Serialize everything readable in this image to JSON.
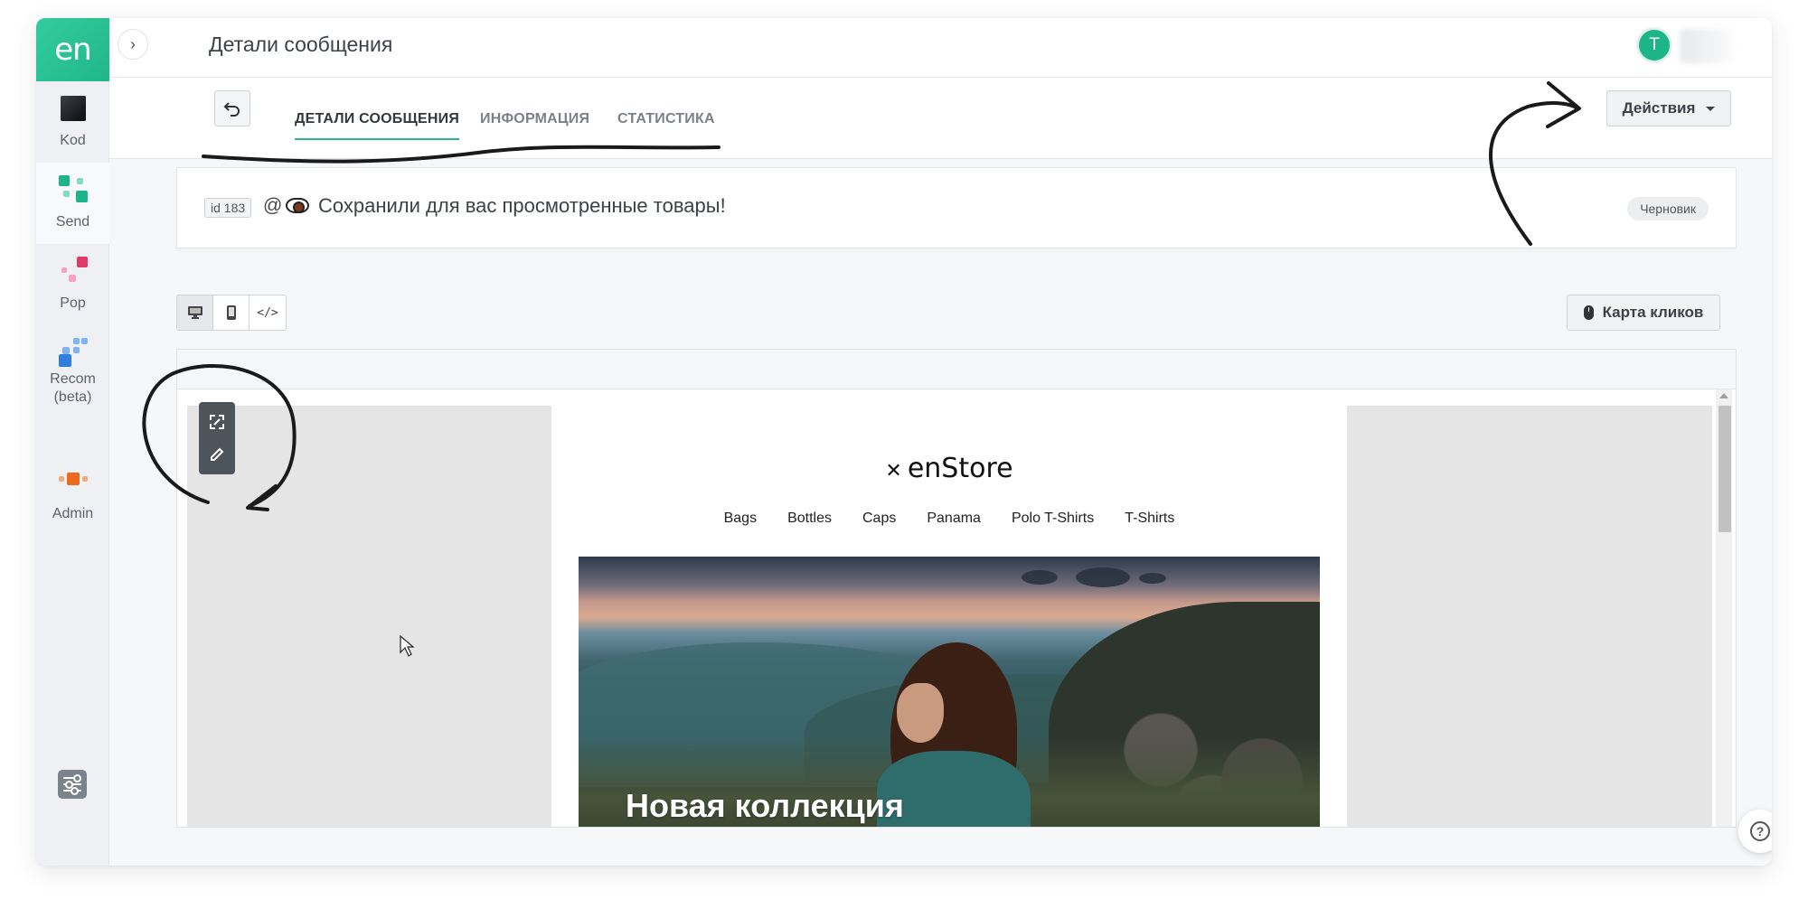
{
  "sidebar": {
    "logo": "en",
    "items": [
      {
        "label": "Kod",
        "icon": "kod-icon"
      },
      {
        "label": "Send",
        "icon": "send-icon",
        "active": true
      },
      {
        "label": "Pop",
        "icon": "pop-icon"
      },
      {
        "label": "Recom",
        "label2": "(beta)",
        "icon": "recom-icon"
      },
      {
        "label": "Admin",
        "icon": "admin-icon"
      }
    ],
    "settings_icon": "sliders-icon"
  },
  "header": {
    "title": "Детали сообщения",
    "avatar_letter": "T"
  },
  "tabs": [
    {
      "label": "ДЕТАЛИ СООБЩЕНИЯ",
      "active": true
    },
    {
      "label": "ИНФОРМАЦИЯ"
    },
    {
      "label": "СТАТИСТИКА"
    }
  ],
  "actions_label": "Действия",
  "message": {
    "id_label": "id 183",
    "at_symbol": "@",
    "subject": "Сохранили для вас просмотренные товары!",
    "status": "Черновик"
  },
  "view_modes": [
    {
      "icon": "desktop-icon",
      "glyph": "🖥",
      "active": true
    },
    {
      "icon": "mobile-icon",
      "glyph": "▯"
    },
    {
      "icon": "code-icon",
      "glyph": "</>"
    }
  ],
  "click_map_label": "Карта кликов",
  "email": {
    "brand": "enStore",
    "nav": [
      "Bags",
      "Bottles",
      "Caps",
      "Panama",
      "Polo T-Shirts",
      "T-Shirts"
    ],
    "hero_title": "Новая коллекция"
  },
  "colors": {
    "accent": "#2ab88c",
    "brand_green": "#1fb689"
  }
}
